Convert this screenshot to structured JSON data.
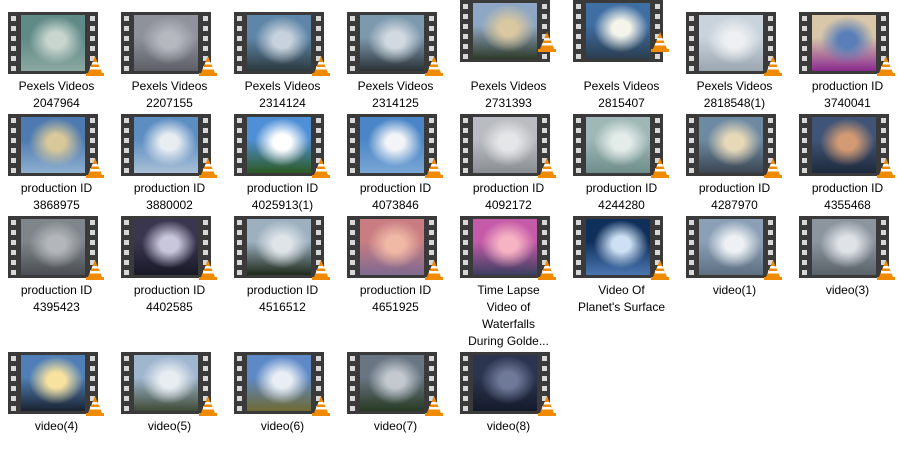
{
  "files": [
    {
      "name": "Pexels Videos 2047964",
      "line1": "Pexels Videos",
      "line2": "2047964",
      "thumb": [
        "#5f8a86",
        "#c9d6cf",
        "#8aa8a0"
      ]
    },
    {
      "name": "Pexels Videos 2207155",
      "line1": "Pexels Videos",
      "line2": "2207155",
      "thumb": [
        "#8f929a",
        "#b5b8bf",
        "#5c5f66"
      ]
    },
    {
      "name": "Pexels Videos 2314124",
      "line1": "Pexels Videos",
      "line2": "2314124",
      "thumb": [
        "#5f86a8",
        "#c7d2dc",
        "#2c3a3e"
      ]
    },
    {
      "name": "Pexels Videos 2314125",
      "line1": "Pexels Videos",
      "line2": "2314125",
      "thumb": [
        "#7d99ae",
        "#d2dae0",
        "#2a3236"
      ]
    },
    {
      "name": "Pexels Videos 2731393",
      "line1": "Pexels Videos",
      "line2": "2731393",
      "thumb": [
        "#8ea7c4",
        "#d9c8a0",
        "#2f3a2a"
      ]
    },
    {
      "name": "Pexels Videos 2815407",
      "line1": "Pexels Videos",
      "line2": "2815407",
      "thumb": [
        "#3f6ea3",
        "#f4f4ea",
        "#2b3d4e"
      ]
    },
    {
      "name": "Pexels Videos 2818548(1)",
      "line1": "Pexels Videos",
      "line2": "2818548(1)",
      "thumb": [
        "#c9d3dc",
        "#eef0f2",
        "#9aa6b0"
      ]
    },
    {
      "name": "production ID 3740041",
      "line1": "production ID",
      "line2": "3740041",
      "thumb": [
        "#d8c7a9",
        "#5a7fb8",
        "#8a2a8f"
      ]
    },
    {
      "name": "production ID 3868975",
      "line1": "production ID",
      "line2": "3868975",
      "thumb": [
        "#4d7ab0",
        "#d9c89a",
        "#8fb0cf"
      ]
    },
    {
      "name": "production ID 3880002",
      "line1": "production ID",
      "line2": "3880002",
      "thumb": [
        "#5d8ec2",
        "#e8edf2",
        "#a9bfd6"
      ]
    },
    {
      "name": "production ID 4025913(1)",
      "line1": "production ID",
      "line2": "4025913(1)",
      "thumb": [
        "#4f8fd6",
        "#ffffff",
        "#2c5a22"
      ]
    },
    {
      "name": "production ID 4073846",
      "line1": "production ID",
      "line2": "4073846",
      "thumb": [
        "#4a86c7",
        "#f2f4f7",
        "#7aa6d6"
      ]
    },
    {
      "name": "production ID 4092172",
      "line1": "production ID",
      "line2": "4092172",
      "thumb": [
        "#b9bcc0",
        "#e5e6e8",
        "#8a8e93"
      ]
    },
    {
      "name": "production ID 4244280",
      "line1": "production ID",
      "line2": "4244280",
      "thumb": [
        "#9fb8b6",
        "#e4ece9",
        "#6e8d8a"
      ]
    },
    {
      "name": "production ID 4287970",
      "line1": "production ID",
      "line2": "4287970",
      "thumb": [
        "#6e8aa3",
        "#e7d9b8",
        "#3b4652"
      ]
    },
    {
      "name": "production ID 4355468",
      "line1": "production ID",
      "line2": "4355468",
      "thumb": [
        "#3f5476",
        "#d49a73",
        "#1e2a3c"
      ]
    },
    {
      "name": "production ID 4395423",
      "line1": "production ID",
      "line2": "4395423",
      "thumb": [
        "#7f858b",
        "#b3b7bb",
        "#4a4e52"
      ]
    },
    {
      "name": "production ID 4402585",
      "line1": "production ID",
      "line2": "4402585",
      "thumb": [
        "#3a3650",
        "#c9c7db",
        "#191826"
      ]
    },
    {
      "name": "production ID 4516512",
      "line1": "production ID",
      "line2": "4516512",
      "thumb": [
        "#9cb0c0",
        "#dfe4e8",
        "#1e2a1c"
      ]
    },
    {
      "name": "production ID 4651925",
      "line1": "production ID",
      "line2": "4651925",
      "thumb": [
        "#c97d83",
        "#f0b9a6",
        "#7e6a90"
      ]
    },
    {
      "name": "Time Lapse Video of Waterfalls During Golde...",
      "line1": "Time Lapse",
      "line2": "Video of",
      "line3": "Waterfalls",
      "line4": "During Golde...",
      "thumb": [
        "#c55aa8",
        "#f6b3c4",
        "#3b3e60"
      ]
    },
    {
      "name": "Video Of Planet's Surface",
      "line1": "Video Of",
      "line2": "Planet's Surface",
      "thumb": [
        "#10305c",
        "#cde0f4",
        "#4a77b0"
      ]
    },
    {
      "name": "video(1)",
      "line1": "video(1)",
      "thumb": [
        "#8ba0b6",
        "#eef1f4",
        "#5e6f82"
      ]
    },
    {
      "name": "video(3)",
      "line1": "video(3)",
      "thumb": [
        "#8c949e",
        "#dfe3e7",
        "#596169"
      ]
    },
    {
      "name": "video(4)",
      "line1": "video(4)",
      "thumb": [
        "#4f7fb6",
        "#f7e2a0",
        "#1a2230"
      ]
    },
    {
      "name": "video(5)",
      "line1": "video(5)",
      "thumb": [
        "#9fb6cf",
        "#e8edf1",
        "#3f4a36"
      ]
    },
    {
      "name": "video(6)",
      "line1": "video(6)",
      "thumb": [
        "#5d89c7",
        "#e9eef5",
        "#6f6a33"
      ]
    },
    {
      "name": "video(7)",
      "line1": "video(7)",
      "thumb": [
        "#687582",
        "#c3c9cf",
        "#283a24"
      ]
    },
    {
      "name": "video(8)",
      "line1": "video(8)",
      "thumb": [
        "#2c3550",
        "#6f7a98",
        "#141a2a"
      ]
    }
  ],
  "icons": {
    "overlay": "vlc-cone-icon",
    "film": "film-strip-icon"
  },
  "colors": {
    "vlc_orange": "#f08a00",
    "vlc_white": "#ffffff",
    "film": "#3a3a3a"
  }
}
